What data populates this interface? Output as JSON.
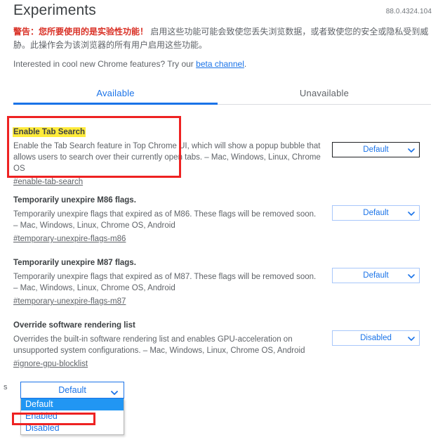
{
  "header": {
    "title": "Experiments",
    "version": "88.0.4324.104"
  },
  "warning": {
    "strong": "警告：您所要使用的是实验性功能！",
    "body": " 启用这些功能可能会致使您丢失浏览数据，或者致使您的安全或隐私受到威胁。此操作会为该浏览器的所有用户启用这些功能。"
  },
  "beta": {
    "prefix": "Interested in cool new Chrome features? Try our ",
    "link": "beta channel",
    "suffix": "."
  },
  "tabs": [
    {
      "label": "Available",
      "active": true
    },
    {
      "label": "Unavailable",
      "active": false
    }
  ],
  "flags": [
    {
      "title": "Enable Tab Search",
      "description": "Enable the Tab Search feature in Top Chrome UI, which will show a popup bubble that allows users to search over their currently open tabs. – Mac, Windows, Linux, Chrome OS",
      "anchor": "#enable-tab-search",
      "select_value": "Default",
      "highlighted": true,
      "focused": true
    },
    {
      "title": "Temporarily unexpire M86 flags.",
      "description": "Temporarily unexpire flags that expired as of M86. These flags will be removed soon. – Mac, Windows, Linux, Chrome OS, Android",
      "anchor": "#temporary-unexpire-flags-m86",
      "select_value": "Default",
      "highlighted": false,
      "focused": false
    },
    {
      "title": "Temporarily unexpire M87 flags.",
      "description": "Temporarily unexpire flags that expired as of M87. These flags will be removed soon. – Mac, Windows, Linux, Chrome OS, Android",
      "anchor": "#temporary-unexpire-flags-m87",
      "select_value": "Default",
      "highlighted": false,
      "focused": false
    },
    {
      "title": "Override software rendering list",
      "description": "Overrides the built-in software rendering list and enables GPU-acceleration on unsupported system configurations. – Mac, Windows, Linux, Chrome OS, Android",
      "anchor": "#ignore-gpu-blocklist",
      "select_value": "Disabled",
      "highlighted": false,
      "focused": false
    }
  ],
  "bottom_dropdown": {
    "stub_label": "s",
    "value": "Default",
    "options": [
      {
        "label": "Default",
        "selected": true
      },
      {
        "label": "Enabled",
        "selected": false
      },
      {
        "label": "Disabled",
        "selected": false
      }
    ]
  },
  "colors": {
    "accent_blue": "#1a73e8",
    "warning_red": "#d93025",
    "annotation_red": "#ee2222",
    "highlight_yellow": "#ffeb3b",
    "selection_blue": "#2196f3"
  }
}
